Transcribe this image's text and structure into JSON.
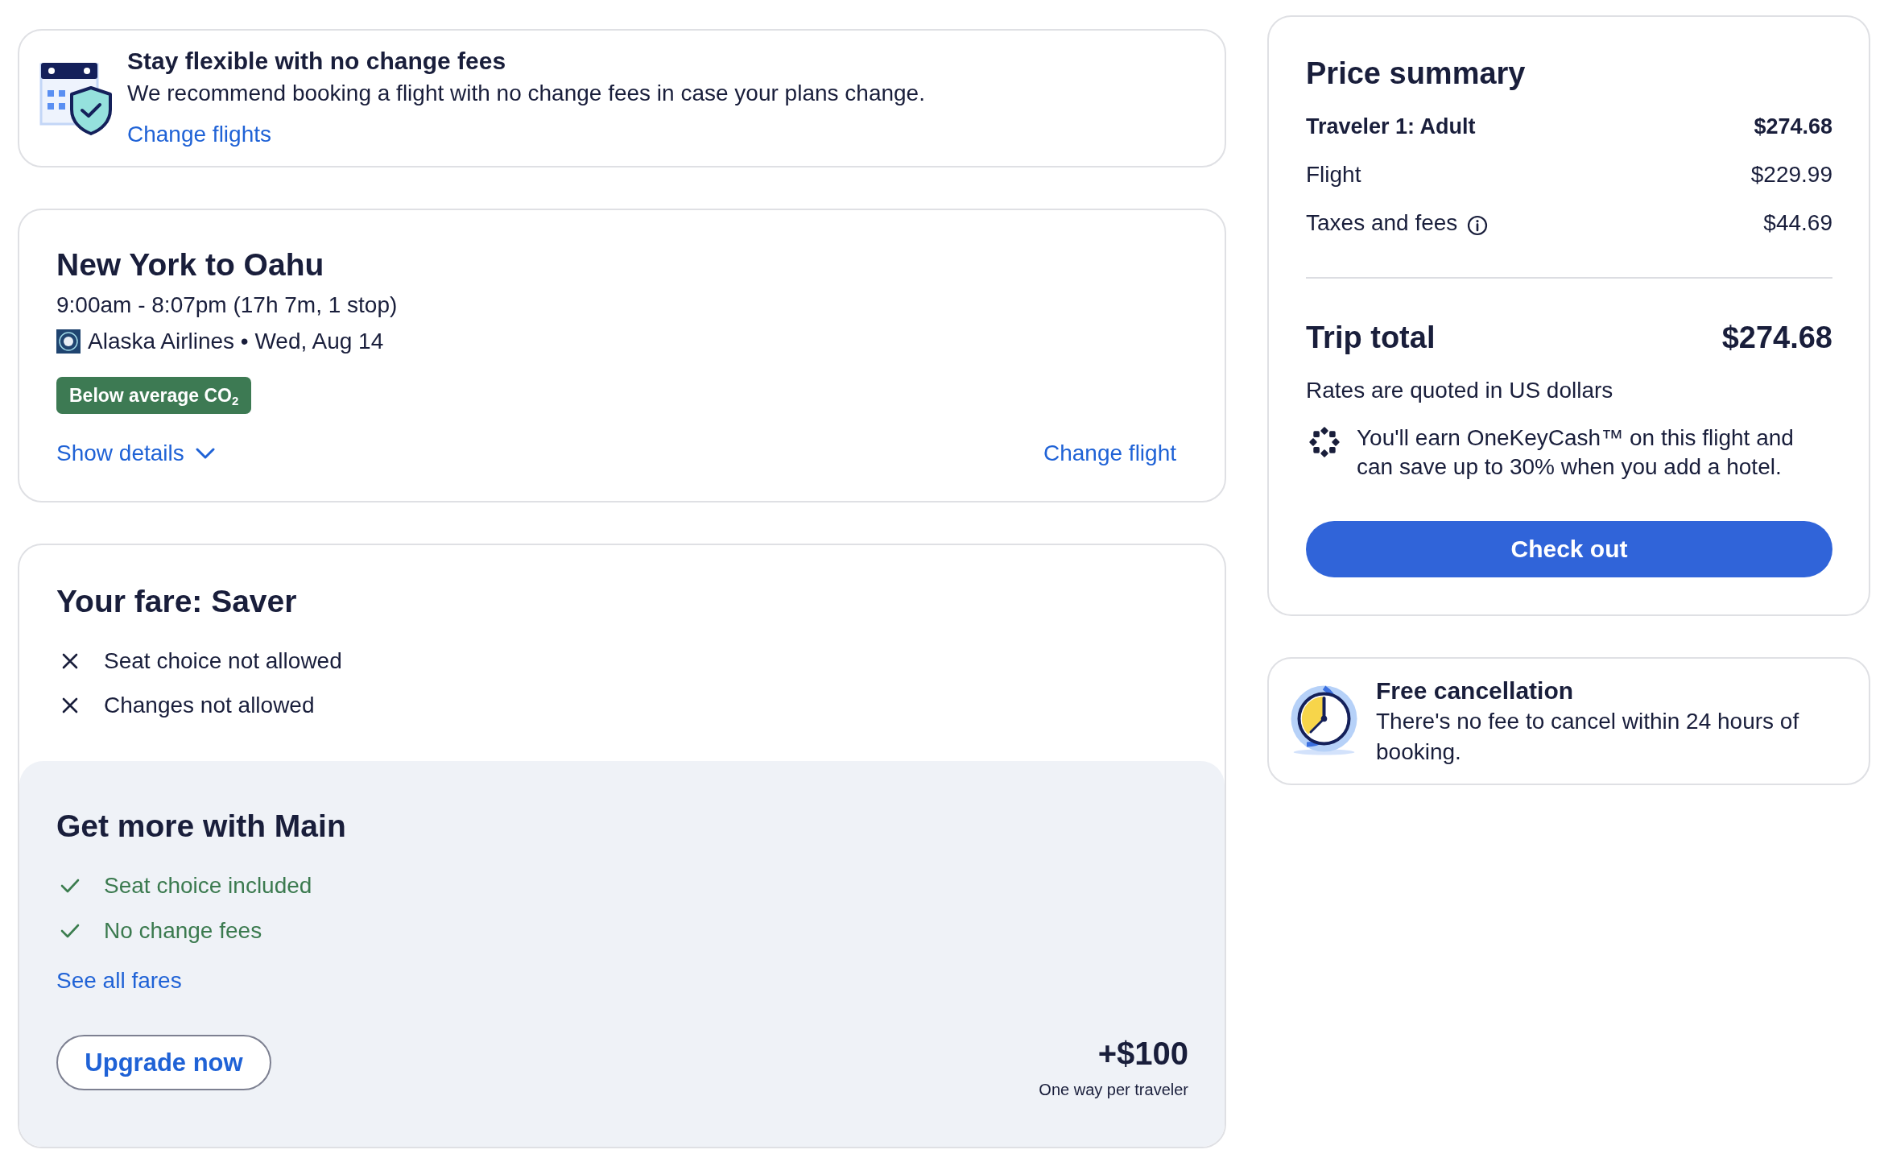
{
  "flex_banner": {
    "title": "Stay flexible with no change fees",
    "text": "We recommend booking a flight with no change fees in case your plans change.",
    "link": "Change flights"
  },
  "flight": {
    "title": "New York to Oahu",
    "times": "9:00am - 8:07pm (17h 7m, 1 stop)",
    "airline_date": "Alaska Airlines • Wed, Aug 14",
    "badge": "Below average CO$_{2}$",
    "details_link": "Show details",
    "expanded": false,
    "change_link": "Change flight"
  },
  "fare": {
    "title": "Your fare: Saver",
    "features": [
      {
        "label": "Seat choice not allowed",
        "included": false
      },
      {
        "label": "Changes not allowed",
        "included": false
      }
    ]
  },
  "upsell": {
    "title": "Get more with Main",
    "features": [
      {
        "label": "Seat choice included",
        "included": true
      },
      {
        "label": "No change fees",
        "included": true
      }
    ],
    "link": "See all fares",
    "button": "Upgrade now",
    "price": "+$100",
    "price_note": "One way per traveler"
  },
  "price_summary": {
    "title": "Price summary",
    "lines": [
      {
        "label": "Traveler 1: Adult",
        "amount": "$274.68",
        "kind": "subtotal",
        "info": false
      },
      {
        "label": "Flight",
        "amount": "$229.99",
        "kind": "item",
        "info": false
      },
      {
        "label": "Taxes and fees",
        "amount": "$44.69",
        "kind": "item",
        "info": true
      }
    ],
    "total_label": "Trip total",
    "total": "$274.68",
    "currency_note": "Rates are quoted in US dollars",
    "rewards_text": "You'll earn OneKeyCash™ on this flight and can save up to 30% when you add a hotel.",
    "button": "Check out"
  },
  "free_cancellation": {
    "title": "Free cancellation",
    "text": "There's no fee to cancel within 24 hours of booking."
  }
}
